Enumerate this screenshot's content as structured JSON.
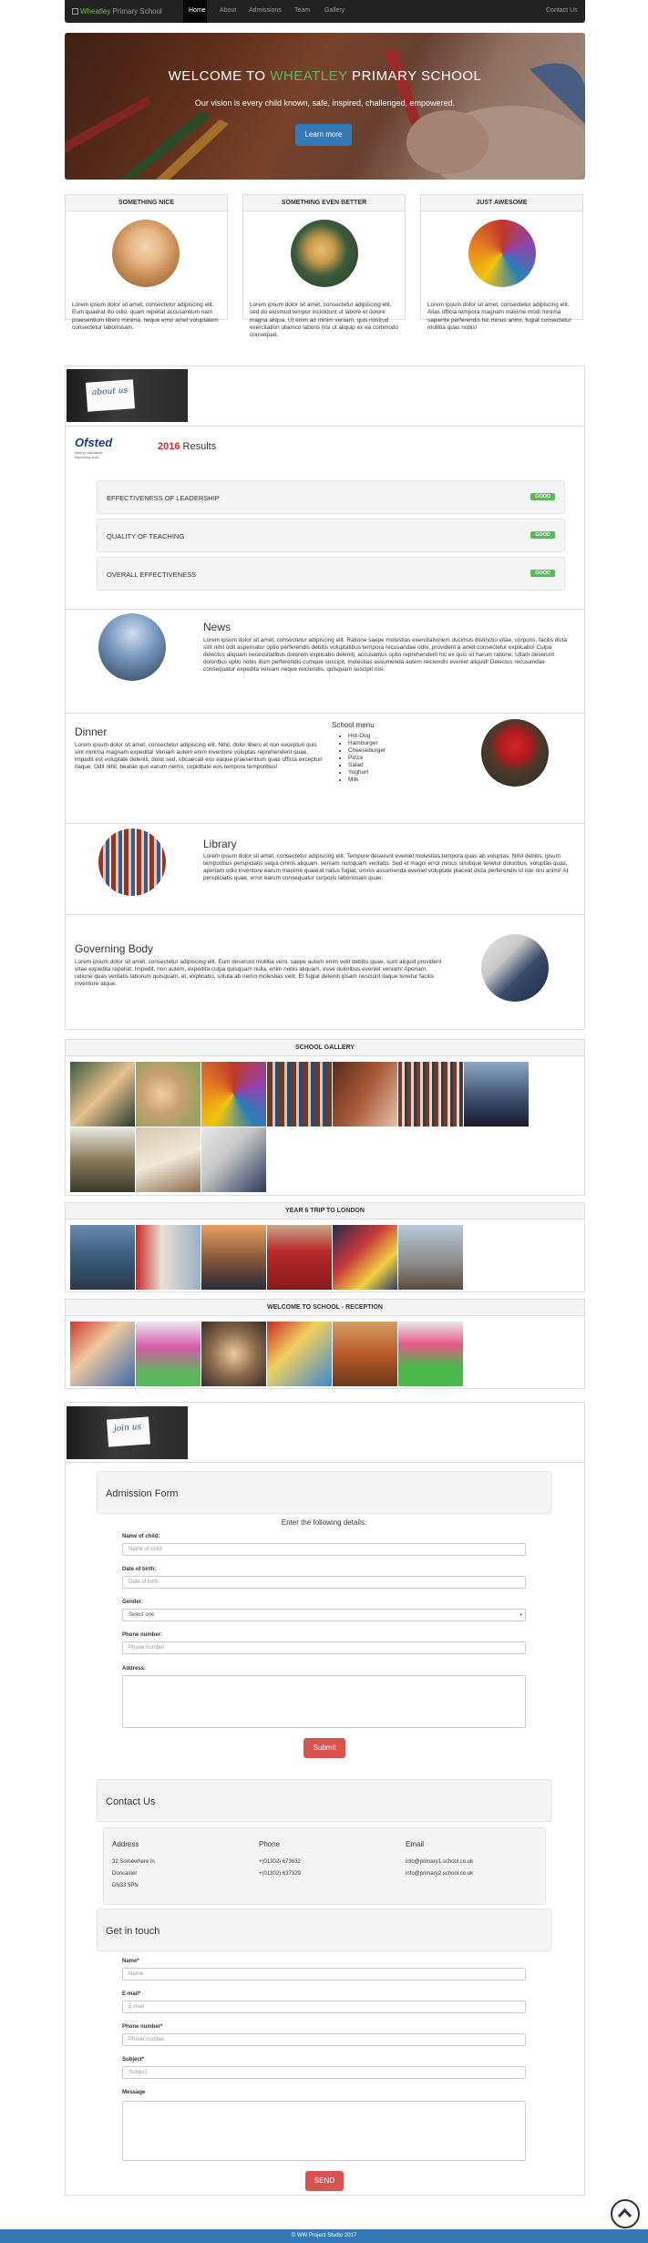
{
  "nav": {
    "brand_a": "Wheatley",
    "brand_b": " Primary School",
    "items": [
      "Home",
      "About",
      "Admissions",
      "Team",
      "Gallery"
    ],
    "right": "Contact Us"
  },
  "hero": {
    "title_a": "WELCOME TO ",
    "title_b": "WHEATLEY",
    "title_c": " PRIMARY SCHOOL",
    "subtitle": "Our vision is every child known, safe, inspired, challenged, empowered.",
    "button": "Learn more"
  },
  "features": [
    {
      "title": "SOMETHING NICE",
      "text": "Lorem ipsum dolor sit amet, consectetur adipiscing elit. Eum quaerat illo odio, quam repellat accusantium nam praesentium libero minima, neque error amet voluptatem consectetur laboriosam."
    },
    {
      "title": "SOMETHING EVEN BETTER",
      "text": "Lorem ipsum dolor sit amet, consectetur adipiscing elit, sed do eiusmod tempor incididunt ut labore et dolore magna aliqua. Ut enim ad minim veniam, quis nostrud exercitation ullamco laboris nisi ut aliquip ex ea commodo consequat."
    },
    {
      "title": "JUST AWESOME",
      "text": "Lorem ipsum dolor sit amet, consectetur adipiscing elit. Alias officia tempora magnam maxime modi minima sapiente perferendis hic minus animi, fugiat consectetur mollitia quas nobis!"
    }
  ],
  "about": {
    "sign": "about us",
    "ofsted": "Ofsted",
    "ofsted_tag": "raising standards improving lives",
    "results_year": "2016",
    "results_label": " Results",
    "ratings": [
      {
        "label": "EFFECTIVENESS OF LEADERSHIP",
        "badge": "GOOD"
      },
      {
        "label": "QUALITY OF TEACHING",
        "badge": "GOOD"
      },
      {
        "label": "OVERALL EFFECTIVENESS",
        "badge": "GOOD"
      }
    ]
  },
  "news": {
    "title": "News",
    "text": "Lorem ipsum dolor sit amet, consectetur adipiscing elit. Ratione saepe molestias exercitationem ducimus distinctio vitae, corporis, facilis dicta sint nihil odit aspernatur optio perferendis debitis voluptatibus tempora recusandae odio, provident a amet consectetur explicabo! Culpa delectus aliquam necessitatibus dolorem explicabo deleniti, accusamus optio reprehenderit hic ex quis sit harum ratione. Ullam deserunt doloribus optio nobis illum perferendis cumque suscipit, molestias assumenda autem reiciendis eveniet aliquid! Delectus recusandae consequatur expedita veniam neque reiciendis, quisquam suscipit nisi."
  },
  "dinner": {
    "title": "Dinner",
    "text": "Lorem ipsum dolor sit amet, consectetur adipiscing elit. Nihil, dolor libero et non excepturi quis sint minima magnam expedita! Veniam autem enim inventore voluptas reprehenderit quae, impedit est voluptate deleniti, dolor sed, obcaecati eos eaque praesentium quas officia excepturi itaque. Odit nihil, beatae quo earum nemo, cupiditate eos tempora temporibus!",
    "menu_title": "School menu",
    "menu": [
      "Hot-Dog",
      "Hamburger",
      "Cheeseburger",
      "Pizza",
      "Salad",
      "Yoghurt",
      "Milk"
    ]
  },
  "library": {
    "title": "Library",
    "text": "Lorem ipsum dolor sit amet, consectetur adipiscing elit. Tempore deserunt eveniet molestias tempora quas ab voluptas. Nihil debitis, ipsum temporibus perspiciatis sequi omnis aliquam, veniam numquam veritatis. Sed et magni error minus similique tenetur doloribus, voluptas quas, aperiam odio inventore earum maxime quaerat natus fugiat, omnis assumenda eveniet voluptate placeat dicta perferendis id iste nisi animi! At perspiciatis quae, error earum consequatur corporis laboriosam quae."
  },
  "governing": {
    "title": "Governing Body",
    "text": "Lorem ipsum dolor sit amet, consectetur adipiscing elit. Eum deserunt mollitia vero, saepe autem enim velit debitis quae, sunt aliquid provident vitae expedita repellat. Impedit, non autem, expedita culpa quisquam nulla, enim nobis aliquam, esse doloribus eveniet veniam! Aperiam, ratione quas veritatis laborum quisquam, et, explicabo, soluta ab nemo molestias velit. Et fugiat deleniti ipsam nesciunt itaque tenetur facilis inventore atque."
  },
  "galleries": {
    "school": "SCHOOL GALLERY",
    "london": "YEAR 6 TRIP TO LONDON",
    "reception": "WELCOME TO SCHOOL - RECEPTION"
  },
  "join": {
    "sign": "join us"
  },
  "admission": {
    "title": "Admission Form",
    "subtitle": "Enter the following details:",
    "name_label": "Name of child:",
    "name_ph": "Name of child",
    "dob_label": "Date of birth:",
    "dob_ph": "Date of birth",
    "gender_label": "Gender:",
    "gender_value": "Select one",
    "phone_label": "Phone number:",
    "phone_ph": "Phone number",
    "address_label": "Address:",
    "submit": "Submit"
  },
  "contact": {
    "title": "Contact Us",
    "address_h": "Address",
    "address": [
      "32 Somewhere in",
      "Doncaster",
      "DN33 5PN"
    ],
    "phone_h": "Phone",
    "phones": [
      "+(01302) 673632",
      "+(01302) 637329"
    ],
    "email_h": "Email",
    "emails": [
      "info@primary1.school.co.uk",
      "info@primary2.school.co.uk"
    ]
  },
  "touch": {
    "title": "Get in touch",
    "name_label": "Name*",
    "name_ph": "Name",
    "email_label": "E-mail*",
    "email_ph": "E-mail",
    "phone_label": "Phone number*",
    "phone_ph": "Phone number",
    "subject_label": "Subject*",
    "subject_ph": "Subject",
    "message_label": "Message",
    "send": "SEND"
  },
  "footer": {
    "text": "© WW Project Studio 2017"
  }
}
